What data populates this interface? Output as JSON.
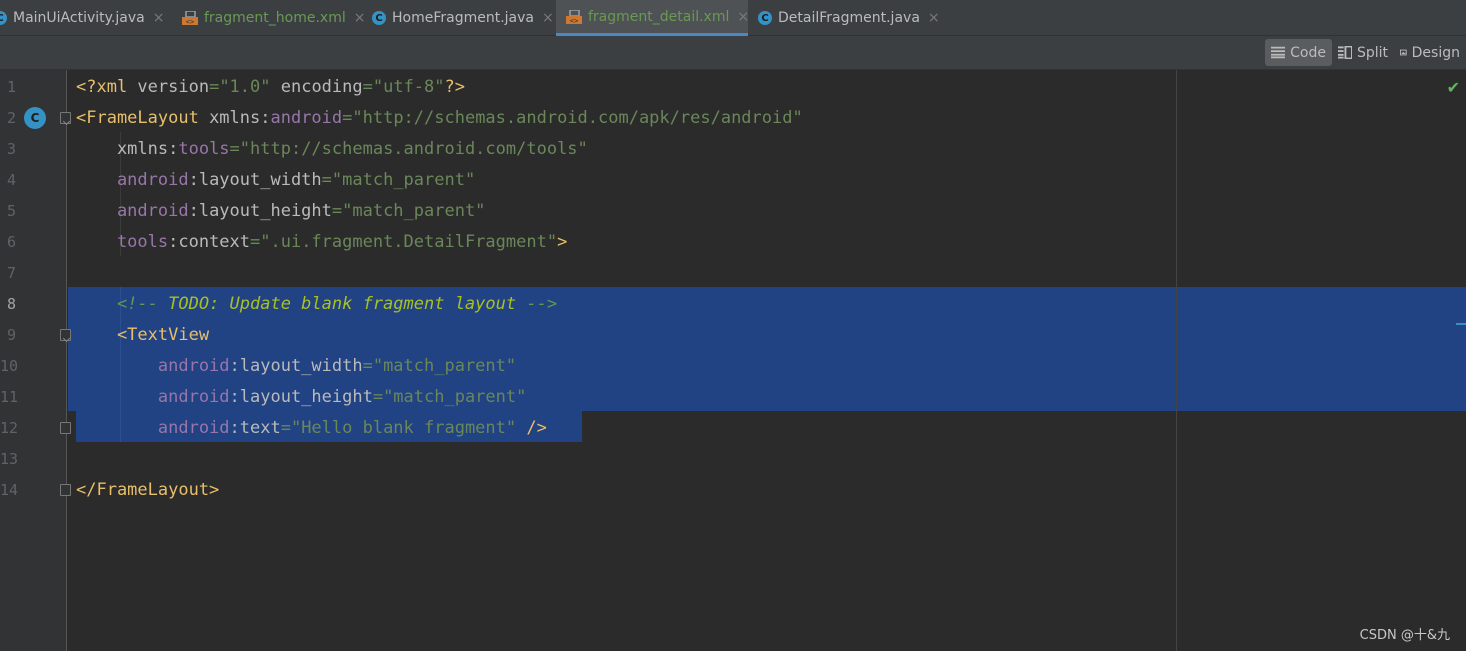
{
  "tabs": [
    {
      "label": "MainUiActivity.java",
      "type": "java",
      "active": false
    },
    {
      "label": "fragment_home.xml",
      "type": "xml",
      "active": false
    },
    {
      "label": "HomeFragment.java",
      "type": "java",
      "active": false
    },
    {
      "label": "fragment_detail.xml",
      "type": "xml",
      "active": true
    },
    {
      "label": "DetailFragment.java",
      "type": "java",
      "active": false
    }
  ],
  "close_glyph": "×",
  "java_icon_letter": "C",
  "view_modes": {
    "code": "Code",
    "split": "Split",
    "design": "Design",
    "selected": "Code"
  },
  "gutter_badge": "C",
  "lines": [
    {
      "num": "1",
      "tokens": [
        {
          "t": "<?xml ",
          "c": "t-tag"
        },
        {
          "t": "version",
          "c": "t-attr"
        },
        {
          "t": "=\"1.0\" ",
          "c": "t-val"
        },
        {
          "t": "encoding",
          "c": "t-attr"
        },
        {
          "t": "=\"utf-8\"",
          "c": "t-val"
        },
        {
          "t": "?>",
          "c": "t-tag"
        }
      ]
    },
    {
      "num": "2",
      "tokens": [
        {
          "t": "<FrameLayout ",
          "c": "t-tag"
        },
        {
          "t": "xmlns:",
          "c": "t-attr"
        },
        {
          "t": "android",
          "c": "t-ns"
        },
        {
          "t": "=\"http://schemas.android.com/apk/res/android\"",
          "c": "t-val"
        }
      ]
    },
    {
      "num": "3",
      "tokens": [
        {
          "t": "    xmlns:",
          "c": "t-attr"
        },
        {
          "t": "tools",
          "c": "t-ns"
        },
        {
          "t": "=\"http://schemas.android.com/tools\"",
          "c": "t-val"
        }
      ]
    },
    {
      "num": "4",
      "tokens": [
        {
          "t": "    android",
          "c": "t-ns"
        },
        {
          "t": ":layout_width",
          "c": "t-attr"
        },
        {
          "t": "=\"match_parent\"",
          "c": "t-val"
        }
      ]
    },
    {
      "num": "5",
      "tokens": [
        {
          "t": "    android",
          "c": "t-ns"
        },
        {
          "t": ":layout_height",
          "c": "t-attr"
        },
        {
          "t": "=\"match_parent\"",
          "c": "t-val"
        }
      ]
    },
    {
      "num": "6",
      "tokens": [
        {
          "t": "    tools",
          "c": "t-ns"
        },
        {
          "t": ":context",
          "c": "t-attr"
        },
        {
          "t": "=\".ui.fragment.DetailFragment\"",
          "c": "t-val"
        },
        {
          "t": ">",
          "c": "t-tag"
        }
      ]
    },
    {
      "num": "7",
      "tokens": []
    },
    {
      "num": "8",
      "tokens": [
        {
          "t": "    <!-- ",
          "c": "t-com"
        },
        {
          "t": "TODO: Update blank fragment layout",
          "c": "t-com-todo"
        },
        {
          "t": " -->",
          "c": "t-com"
        }
      ]
    },
    {
      "num": "9",
      "tokens": [
        {
          "t": "    <TextView",
          "c": "t-tag"
        }
      ]
    },
    {
      "num": "10",
      "tokens": [
        {
          "t": "        android",
          "c": "t-ns"
        },
        {
          "t": ":layout_width",
          "c": "t-attr"
        },
        {
          "t": "=\"match_parent\"",
          "c": "t-val"
        }
      ]
    },
    {
      "num": "11",
      "tokens": [
        {
          "t": "        android",
          "c": "t-ns"
        },
        {
          "t": ":layout_height",
          "c": "t-attr"
        },
        {
          "t": "=\"match_parent\"",
          "c": "t-val"
        }
      ]
    },
    {
      "num": "12",
      "tokens": [
        {
          "t": "        android",
          "c": "t-ns"
        },
        {
          "t": ":text",
          "c": "t-attr"
        },
        {
          "t": "=\"Hello blank fragment\" ",
          "c": "t-val"
        },
        {
          "t": "/>",
          "c": "t-tag"
        }
      ]
    },
    {
      "num": "13",
      "tokens": []
    },
    {
      "num": "14",
      "tokens": [
        {
          "t": "</FrameLayout>",
          "c": "t-tag"
        }
      ]
    }
  ],
  "inspection_status": "✔",
  "watermark": "CSDN @十&九"
}
